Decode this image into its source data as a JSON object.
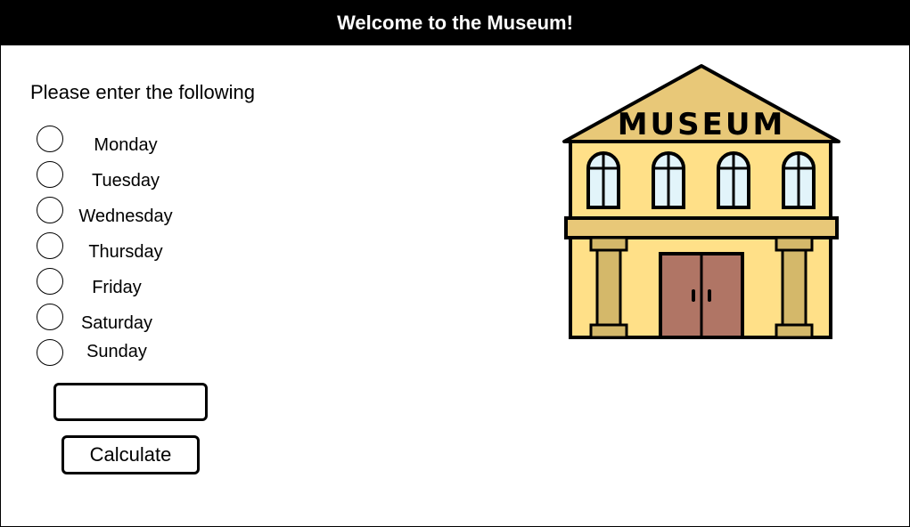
{
  "header": {
    "title": "Welcome to the Museum!",
    "background": "#000000",
    "color": "#ffffff"
  },
  "form": {
    "prompt": "Please enter the following",
    "days": [
      {
        "label": "Monday"
      },
      {
        "label": "Tuesday"
      },
      {
        "label": "Wednesday"
      },
      {
        "label": "Thursday"
      },
      {
        "label": "Friday"
      },
      {
        "label": "Saturday"
      },
      {
        "label": "Sunday"
      }
    ],
    "input_value": "",
    "calculate_label": "Calculate"
  },
  "illustration": {
    "icon": "museum-building-icon",
    "sign_text": "MUSEUM",
    "colors": {
      "roof": "#E8C878",
      "walls": "#FFE088",
      "pillars": "#D4B86A",
      "windows": "#E2F4FA",
      "doors": "#B07565",
      "outline": "#000000"
    }
  }
}
